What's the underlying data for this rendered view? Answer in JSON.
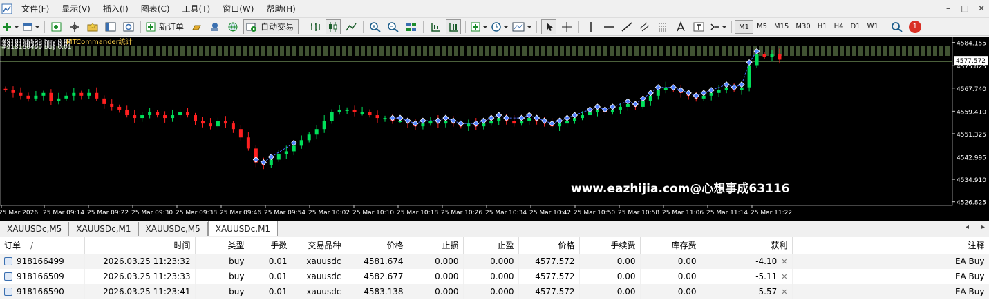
{
  "menu": {
    "items": [
      "文件(F)",
      "显示(V)",
      "插入(I)",
      "图表(C)",
      "工具(T)",
      "窗口(W)",
      "帮助(H)"
    ],
    "window_controls": [
      "–",
      "□",
      "✕"
    ]
  },
  "toolbar": {
    "new_order_label": "新订单",
    "auto_trade_label": "自动交易",
    "timeframes": [
      "M1",
      "M5",
      "M15",
      "M30",
      "H1",
      "H4",
      "D1",
      "W1"
    ],
    "active_timeframe": "M1",
    "notification_count": "1"
  },
  "chart": {
    "symbol_overlay_lines": [
      "#918166590 buy 0.01",
      "#918166509 buy 0.01",
      "#918166499 buy 0.01"
    ],
    "indicator_label": "MTCommander统计",
    "watermark": "www.eazhijia.com@心想事成63116",
    "current_price": "4577.572",
    "colors": {
      "bull": "#00e05a",
      "bear": "#ff2020",
      "price_tag_bg": "#ffffff",
      "grid_dash": "#c8ff9e"
    }
  },
  "chart_data": {
    "type": "candlestick",
    "y_axis_labels": [
      "4584.155",
      "4575.825",
      "4567.740",
      "4559.410",
      "4551.325",
      "4542.995",
      "4534.910",
      "4526.825"
    ],
    "y_axis_values": [
      4584.155,
      4575.825,
      4567.74,
      4559.41,
      4551.325,
      4542.995,
      4534.91,
      4526.825
    ],
    "ylim": [
      4525.5,
      4585.8
    ],
    "x_axis_labels": [
      "25 Mar 2026",
      "25 Mar 09:14",
      "25 Mar 09:22",
      "25 Mar 09:30",
      "25 Mar 09:38",
      "25 Mar 09:46",
      "25 Mar 09:54",
      "25 Mar 10:02",
      "25 Mar 10:10",
      "25 Mar 10:18",
      "25 Mar 10:26",
      "25 Mar 10:34",
      "25 Mar 10:42",
      "25 Mar 10:50",
      "25 Mar 10:58",
      "25 Mar 11:06",
      "25 Mar 11:14",
      "25 Mar 11:22"
    ],
    "close_path": [
      4567,
      4566,
      4565,
      4564,
      4565,
      4566,
      4563,
      4564,
      4565,
      4566,
      4565,
      4566,
      4564,
      4562,
      4561,
      4560,
      4558,
      4557,
      4558,
      4559,
      4558,
      4557,
      4558,
      4559,
      4558,
      4556,
      4555,
      4554,
      4556,
      4555,
      4553,
      4550,
      4546,
      4541,
      4540,
      4542,
      4544,
      4545,
      4547,
      4549,
      4551,
      4553,
      4556,
      4559,
      4560,
      4560,
      4559,
      4559,
      4558,
      4557,
      4557,
      4556,
      4556,
      4555,
      4554,
      4555,
      4556,
      4555,
      4556,
      4555,
      4554,
      4555,
      4554,
      4555,
      4556,
      4557,
      4556,
      4555,
      4556,
      4557,
      4556,
      4555,
      4554,
      4555,
      4556,
      4557,
      4558,
      4559,
      4560,
      4559,
      4560,
      4561,
      4562,
      4561,
      4563,
      4565,
      4567,
      4568,
      4567,
      4566,
      4565,
      4564,
      4565,
      4566,
      4567,
      4568,
      4567,
      4568,
      4576,
      4580,
      4579,
      4580,
      4578
    ]
  },
  "tabs": [
    "XAUUSDc,M5",
    "XAUUSDc,M1",
    "XAUUSDc,M5",
    "XAUUSDc,M1"
  ],
  "active_tab_index": 3,
  "tab_nav": [
    "◂",
    "▸"
  ],
  "table": {
    "headers": [
      "订单",
      "时间",
      "类型",
      "手数",
      "交易品种",
      "价格",
      "止损",
      "止盈",
      "价格",
      "手续费",
      "库存费",
      "获利",
      "注释"
    ],
    "sort_indicator": "/",
    "rows": [
      [
        "918166499",
        "2026.03.25 11:23:32",
        "buy",
        "0.01",
        "xauusdc",
        "4581.674",
        "0.000",
        "0.000",
        "4577.572",
        "0.00",
        "0.00",
        "-4.10",
        "EA Buy"
      ],
      [
        "918166509",
        "2026.03.25 11:23:33",
        "buy",
        "0.01",
        "xauusdc",
        "4582.677",
        "0.000",
        "0.000",
        "4577.572",
        "0.00",
        "0.00",
        "-5.11",
        "EA Buy"
      ],
      [
        "918166590",
        "2026.03.25 11:23:41",
        "buy",
        "0.01",
        "xauusdc",
        "4583.138",
        "0.000",
        "0.000",
        "4577.572",
        "0.00",
        "0.00",
        "-5.57",
        "EA Buy"
      ]
    ]
  }
}
